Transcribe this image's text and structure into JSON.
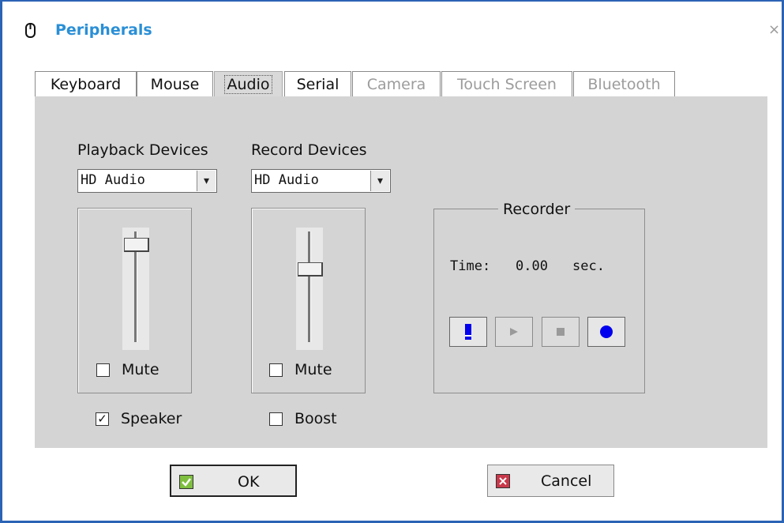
{
  "window": {
    "title": "Peripherals",
    "title_icon": "mouse-icon",
    "close_glyph": "×"
  },
  "tabs": [
    {
      "label": "Keyboard",
      "state": "enabled"
    },
    {
      "label": "Mouse",
      "state": "enabled"
    },
    {
      "label": "Audio",
      "state": "active"
    },
    {
      "label": "Serial",
      "state": "enabled"
    },
    {
      "label": "Camera",
      "state": "disabled"
    },
    {
      "label": "Touch Screen",
      "state": "disabled"
    },
    {
      "label": "Bluetooth",
      "state": "disabled"
    }
  ],
  "playback": {
    "label": "Playback Devices",
    "device": "HD Audio",
    "volume_fraction": 0.88,
    "mute_label": "Mute",
    "mute_checked": false,
    "speaker_label": "Speaker",
    "speaker_checked": true
  },
  "record": {
    "label": "Record Devices",
    "device": "HD Audio",
    "volume_fraction": 0.66,
    "mute_label": "Mute",
    "mute_checked": false,
    "boost_label": "Boost",
    "boost_checked": false
  },
  "recorder": {
    "title": "Recorder",
    "time_label": "Time:",
    "time_value": "0.00",
    "time_unit": "sec.",
    "buttons": [
      "level-meter-icon",
      "play-icon",
      "stop-icon",
      "record-icon"
    ]
  },
  "dialog_buttons": {
    "ok": "OK",
    "cancel": "Cancel"
  },
  "colors": {
    "accent_blue": "#2b63b5",
    "title_blue": "#2a8fd6",
    "record_blue": "#0000ee",
    "panel_gray": "#d4d4d4"
  },
  "check_glyph": "✓"
}
